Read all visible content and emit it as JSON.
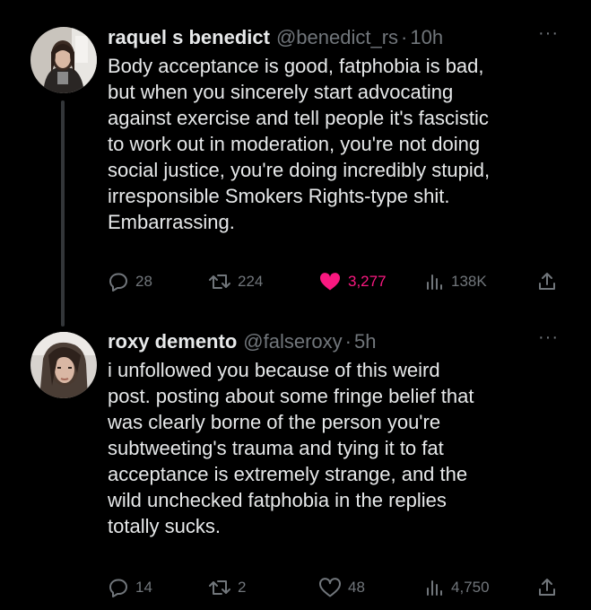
{
  "tweets": [
    {
      "author_name": "raquel s benedict",
      "handle": "@benedict_rs",
      "separator": "·",
      "time": "10h",
      "more": "···",
      "text": "Body acceptance is good, fatphobia is bad,\nbut when you sincerely start advocating\nagainst exercise and tell people it's fascistic\nto work out in moderation, you're not doing\nsocial justice, you're doing incredibly stupid,\nirresponsible Smokers Rights-type shit.\nEmbarrassing.",
      "replies": "28",
      "reposts": "224",
      "likes": "3,277",
      "liked": true,
      "views": "138K",
      "like_color": "#f91880"
    },
    {
      "author_name": "roxy demento",
      "handle": "@falseroxy",
      "separator": "·",
      "time": "5h",
      "more": "···",
      "text": "i unfollowed you because of this weird\npost. posting about some fringe belief that\nwas clearly borne of the person you're\nsubtweeting's trauma and tying it to fat\nacceptance is extremely strange, and the\nwild unchecked fatphobia in the replies\ntotally sucks.",
      "replies": "14",
      "reposts": "2",
      "likes": "48",
      "liked": false,
      "views": "4,750"
    }
  ],
  "icons": [
    "reply-icon",
    "repost-icon",
    "like-icon",
    "views-icon",
    "share-icon"
  ],
  "colors": {
    "background": "#000000",
    "text": "#e7e9ea",
    "muted": "#71767b",
    "like": "#f91880"
  }
}
